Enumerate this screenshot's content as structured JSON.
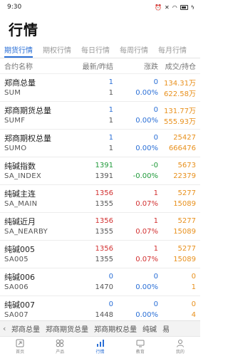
{
  "status": {
    "time": "9:30"
  },
  "header": {
    "title": "行情"
  },
  "tabs": [
    "期货行情",
    "期权行情",
    "每日行情",
    "每周行情",
    "每月行情"
  ],
  "columns": {
    "name": "合约名称",
    "price": "最新/昨结",
    "change": "涨跌",
    "vol": "成交/持仓"
  },
  "rows": [
    {
      "name": "郑商总量",
      "code": "SUM",
      "last": "1",
      "prev": "1",
      "change": "0",
      "pct": "0.00%",
      "vol": "134.31万",
      "oi": "622.58万",
      "last_color": "blue",
      "change_color": "blue",
      "pct_color": "blue"
    },
    {
      "name": "郑商期货总量",
      "code": "SUMF",
      "last": "1",
      "prev": "1",
      "change": "0",
      "pct": "0.00%",
      "vol": "131.77万",
      "oi": "555.93万",
      "last_color": "blue",
      "change_color": "blue",
      "pct_color": "blue"
    },
    {
      "name": "郑商期权总量",
      "code": "SUMO",
      "last": "1",
      "prev": "1",
      "change": "0",
      "pct": "0.00%",
      "vol": "25427",
      "oi": "666476",
      "last_color": "blue",
      "change_color": "blue",
      "pct_color": "blue"
    },
    {
      "name": "纯碱指数",
      "code": "SA_INDEX",
      "last": "1391",
      "prev": "1391",
      "change": "-0",
      "pct": "-0.00%",
      "vol": "5673",
      "oi": "22379",
      "last_color": "green",
      "change_color": "green",
      "pct_color": "green"
    },
    {
      "name": "纯碱主连",
      "code": "SA_MAIN",
      "last": "1356",
      "prev": "1355",
      "change": "1",
      "pct": "0.07%",
      "vol": "5277",
      "oi": "15089",
      "last_color": "red",
      "change_color": "red",
      "pct_color": "red"
    },
    {
      "name": "纯碱近月",
      "code": "SA_NEARBY",
      "last": "1356",
      "prev": "1355",
      "change": "1",
      "pct": "0.07%",
      "vol": "5277",
      "oi": "15089",
      "last_color": "red",
      "change_color": "red",
      "pct_color": "red"
    },
    {
      "name": "纯碱005",
      "code": "SA005",
      "last": "1356",
      "prev": "1355",
      "change": "1",
      "pct": "0.07%",
      "vol": "5277",
      "oi": "15089",
      "last_color": "red",
      "change_color": "red",
      "pct_color": "red"
    },
    {
      "name": "纯碱006",
      "code": "SA006",
      "last": "0",
      "prev": "1470",
      "change": "0",
      "pct": "0.00%",
      "vol": "0",
      "oi": "1",
      "last_color": "blue",
      "change_color": "blue",
      "pct_color": "blue"
    },
    {
      "name": "纯碱007",
      "code": "SA007",
      "last": "0",
      "prev": "1448",
      "change": "0",
      "pct": "0.00%",
      "vol": "0",
      "oi": "4",
      "last_color": "blue",
      "change_color": "blue",
      "pct_color": "blue"
    }
  ],
  "quick_bar": {
    "items": [
      "郑商总量",
      "郑商期货总量",
      "郑商期权总量",
      "纯碱",
      "易"
    ]
  },
  "nav": [
    "首页",
    "产品",
    "行情",
    "教育",
    "我的"
  ],
  "colors": {
    "blue": "#2a6fd6",
    "red": "#d23030",
    "green": "#1f9a3a",
    "orange": "#e8901c"
  }
}
